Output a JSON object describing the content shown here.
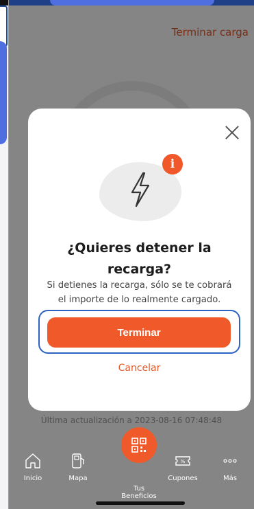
{
  "header": {
    "terminar_carga_link": "Terminar carga"
  },
  "background": {
    "updated_text": "Última actualización a 2023-08-16 07:48:48"
  },
  "modal": {
    "info_badge": "i",
    "title_line1": "¿Quieres detener la",
    "title_line2": "recarga?",
    "body_line1": "Si detienes la recarga, sólo se te cobrará",
    "body_line2": "el importe de lo realmente cargado.",
    "primary_button": "Terminar",
    "secondary_link": "Cancelar"
  },
  "bottom_nav": {
    "items": [
      {
        "label": "Inicio",
        "icon": "home-icon"
      },
      {
        "label": "Mapa",
        "icon": "charger-map-icon"
      },
      {
        "label": "Tus Beneficios",
        "icon": "qr-code-icon"
      },
      {
        "label": "Cupones",
        "icon": "coupon-icon"
      },
      {
        "label": "Más",
        "icon": "more-dots-icon"
      }
    ]
  },
  "colors": {
    "accent": "#f05a2a",
    "focus_ring": "#2d63c0"
  }
}
